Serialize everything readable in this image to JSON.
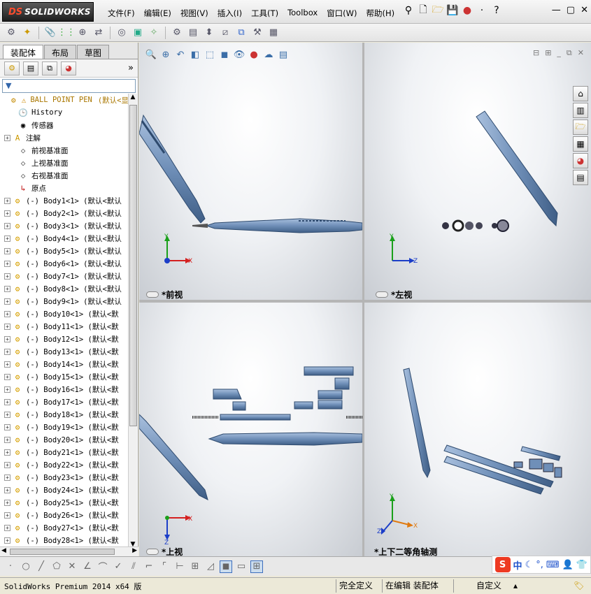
{
  "app": {
    "logo_ds": "DS",
    "logo_text": "SOLIDWORKS"
  },
  "menu": [
    {
      "label": "文件(F)"
    },
    {
      "label": "编辑(E)"
    },
    {
      "label": "视图(V)"
    },
    {
      "label": "插入(I)"
    },
    {
      "label": "工具(T)"
    },
    {
      "label": "Toolbox"
    },
    {
      "label": "窗口(W)"
    },
    {
      "label": "帮助(H)"
    }
  ],
  "left_panel": {
    "tabs": [
      "装配体",
      "布局",
      "草图"
    ],
    "active_tab": "装配体",
    "filter_icon": "filter-icon",
    "root": {
      "name": "BALL POINT PEN",
      "config": "(默认<显"
    },
    "fixed_items": [
      {
        "label": "History",
        "icon": "history-icon"
      },
      {
        "label": "传感器",
        "icon": "sensor-icon"
      },
      {
        "label": "注解",
        "icon": "annotation-icon"
      },
      {
        "label": "前视基准面",
        "icon": "plane-icon"
      },
      {
        "label": "上视基准面",
        "icon": "plane-icon"
      },
      {
        "label": "右视基准面",
        "icon": "plane-icon"
      },
      {
        "label": "原点",
        "icon": "origin-icon"
      }
    ],
    "bodies": [
      {
        "label": "(-) Body1<1> (默认<默认"
      },
      {
        "label": "(-) Body2<1> (默认<默认"
      },
      {
        "label": "(-) Body3<1> (默认<默认"
      },
      {
        "label": "(-) Body4<1> (默认<默认"
      },
      {
        "label": "(-) Body5<1> (默认<默认"
      },
      {
        "label": "(-) Body6<1> (默认<默认"
      },
      {
        "label": "(-) Body7<1> (默认<默认"
      },
      {
        "label": "(-) Body8<1> (默认<默认"
      },
      {
        "label": "(-) Body9<1> (默认<默认"
      },
      {
        "label": "(-) Body10<1> (默认<默"
      },
      {
        "label": "(-) Body11<1> (默认<默"
      },
      {
        "label": "(-) Body12<1> (默认<默"
      },
      {
        "label": "(-) Body13<1> (默认<默"
      },
      {
        "label": "(-) Body14<1> (默认<默"
      },
      {
        "label": "(-) Body15<1> (默认<默"
      },
      {
        "label": "(-) Body16<1> (默认<默"
      },
      {
        "label": "(-) Body17<1> (默认<默"
      },
      {
        "label": "(-) Body18<1> (默认<默"
      },
      {
        "label": "(-) Body19<1> (默认<默"
      },
      {
        "label": "(-) Body20<1> (默认<默"
      },
      {
        "label": "(-) Body21<1> (默认<默"
      },
      {
        "label": "(-) Body22<1> (默认<默"
      },
      {
        "label": "(-) Body23<1> (默认<默"
      },
      {
        "label": "(-) Body24<1> (默认<默"
      },
      {
        "label": "(-) Body25<1> (默认<默"
      },
      {
        "label": "(-) Body26<1> (默认<默"
      },
      {
        "label": "(-) Body27<1> (默认<默"
      },
      {
        "label": "(-) Body28<1> (默认<默"
      }
    ]
  },
  "viewports": [
    {
      "name": "*前视",
      "axes": [
        "Y",
        "X"
      ]
    },
    {
      "name": "*左视",
      "axes": [
        "Y",
        "Z"
      ]
    },
    {
      "name": "*上视",
      "axes": [
        "X",
        "Z"
      ]
    },
    {
      "name": "*上下二等角轴测",
      "axes": [
        "Y",
        "Z",
        "X"
      ]
    }
  ],
  "status": {
    "product": "SolidWorks Premium 2014 x64 版",
    "state": "完全定义",
    "mode": "在编辑 装配体",
    "units": "自定义"
  },
  "ime": {
    "brand": "S",
    "lang": "中"
  },
  "colors": {
    "part_blue": "#6f8fb8",
    "part_dark": "#3f5e86",
    "axis_green": "#1aa01a",
    "axis_red": "#d42020",
    "axis_blue": "#1c3ec8"
  }
}
